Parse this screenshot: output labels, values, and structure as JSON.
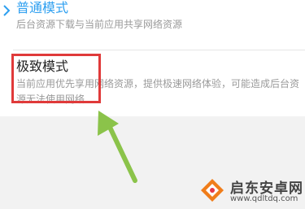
{
  "options": [
    {
      "title": "普通模式",
      "description": "后台资源下载与当前应用共享网络资源",
      "selected": true
    },
    {
      "title": "极致模式",
      "description": "当前应用优先享用网络资源，提供极速网络体验，可能造成后台资源无法使用网络",
      "selected": false
    }
  ],
  "annotation": {
    "box_color": "#e03a3a",
    "arrow_color": "#8bc34a"
  },
  "watermark": {
    "brand": "启东安卓网",
    "url": "www.qdltdq.com"
  },
  "colors": {
    "accent": "#2d9ff0"
  }
}
